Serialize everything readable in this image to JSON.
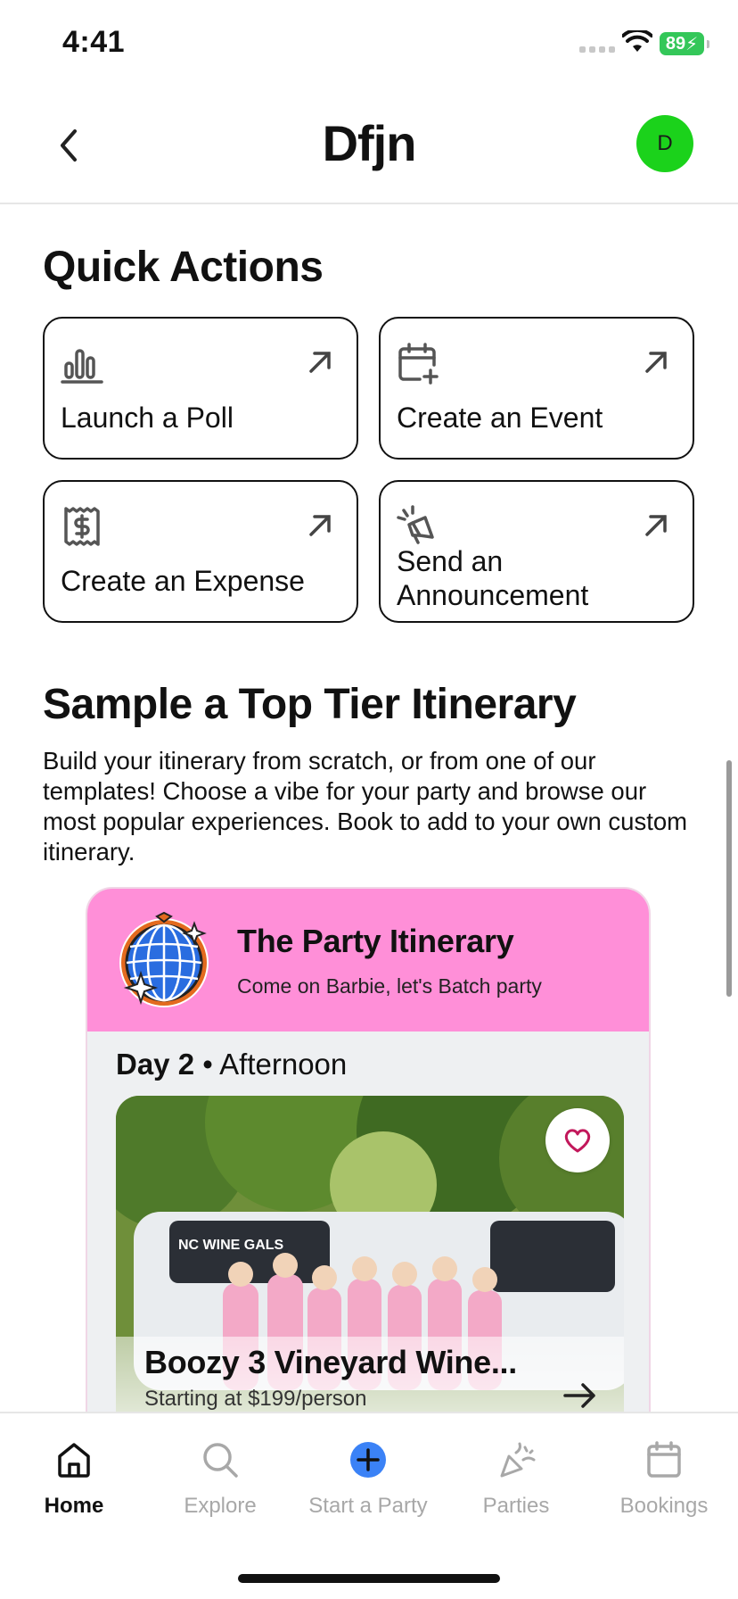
{
  "status_bar": {
    "time": "4:41",
    "battery": "89"
  },
  "header": {
    "title": "Dfjn",
    "avatar_initial": "D"
  },
  "quick_actions": {
    "title": "Quick Actions",
    "items": [
      {
        "label": "Launch a Poll",
        "icon": "bar-chart-icon"
      },
      {
        "label": "Create an Event",
        "icon": "calendar-plus-icon"
      },
      {
        "label": "Create an Expense",
        "icon": "receipt-dollar-icon"
      },
      {
        "label": "Send an Announcement",
        "icon": "megaphone-icon"
      }
    ]
  },
  "itinerary": {
    "title": "Sample a Top Tier Itinerary",
    "description": "Build your itinerary from scratch, or from one of our templates! Choose a vibe for your party and browse our most popular experiences. Book to add to your own custom itinerary.",
    "card": {
      "name": "The Party Itinerary",
      "tagline": "Come on Barbie, let's Batch party",
      "day": "Day 2",
      "separator": "•",
      "time_of_day": "Afternoon",
      "experience": {
        "name": "Boozy 3 Vineyard Wine...",
        "price": "Starting at $199/person",
        "photo_text": "NC WINE GALS"
      }
    }
  },
  "tab_bar": {
    "items": [
      {
        "label": "Home",
        "active": true
      },
      {
        "label": "Explore",
        "active": false
      },
      {
        "label": "Start a Party",
        "active": false
      },
      {
        "label": "Parties",
        "active": false
      },
      {
        "label": "Bookings",
        "active": false
      }
    ]
  },
  "colors": {
    "accent_pink": "#ff8fd8",
    "avatar_green": "#1bd21b",
    "start_blue": "#3b82f6",
    "battery_green": "#34c759"
  }
}
